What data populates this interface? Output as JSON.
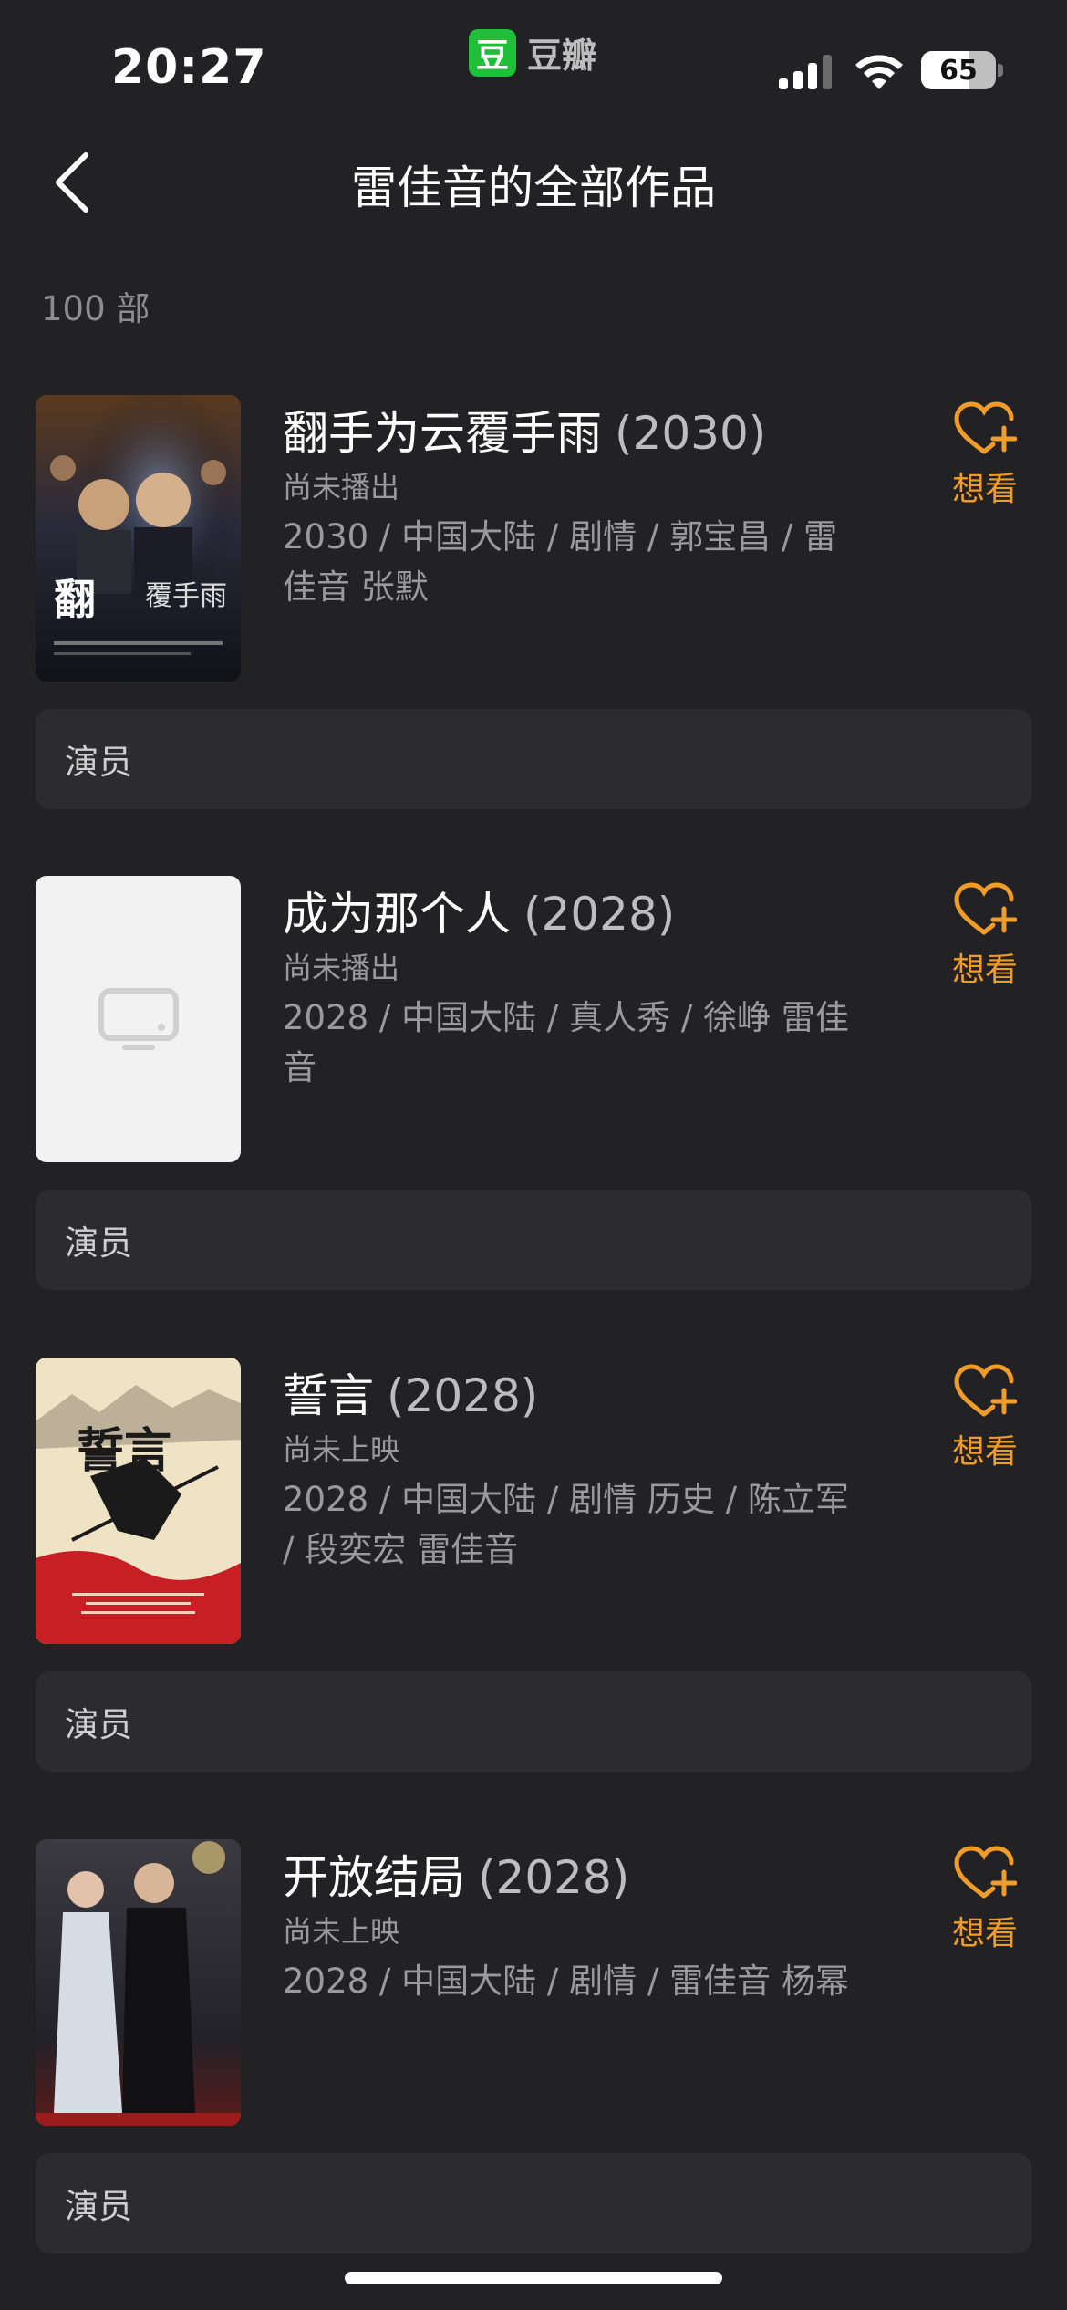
{
  "status_bar": {
    "time": "20:27",
    "app_logo_char": "豆",
    "app_name": "豆瓣",
    "battery_level": 65,
    "battery_text": "65"
  },
  "header": {
    "title": "雷佳音的全部作品",
    "back_icon": "chevron-left-icon"
  },
  "count_text": "100 部",
  "accent_color": "#f09c29",
  "works": [
    {
      "title": "翻手为云覆手雨",
      "year": "(2030)",
      "status": "尚未播出",
      "meta": "2030 / 中国大陆 / 剧情 / 郭宝昌 / 雷佳音 张默",
      "wish_label": "想看",
      "role": "演员",
      "poster": "drama-poster"
    },
    {
      "title": "成为那个人",
      "year": "(2028)",
      "status": "尚未播出",
      "meta": "2028 / 中国大陆 / 真人秀 / 徐峥 雷佳音",
      "wish_label": "想看",
      "role": "演员",
      "poster": "placeholder-tv-icon"
    },
    {
      "title": "誓言",
      "year": "(2028)",
      "status": "尚未上映",
      "meta": "2028 / 中国大陆 / 剧情 历史 / 陈立军 / 段奕宏 雷佳音",
      "wish_label": "想看",
      "role": "演员",
      "poster": "ink-poster"
    },
    {
      "title": "开放结局",
      "year": "(2028)",
      "status": "尚未上映",
      "meta": "2028 / 中国大陆 / 剧情 / 雷佳音 杨幂",
      "wish_label": "想看",
      "role": "演员",
      "poster": "red-carpet-photo"
    }
  ]
}
